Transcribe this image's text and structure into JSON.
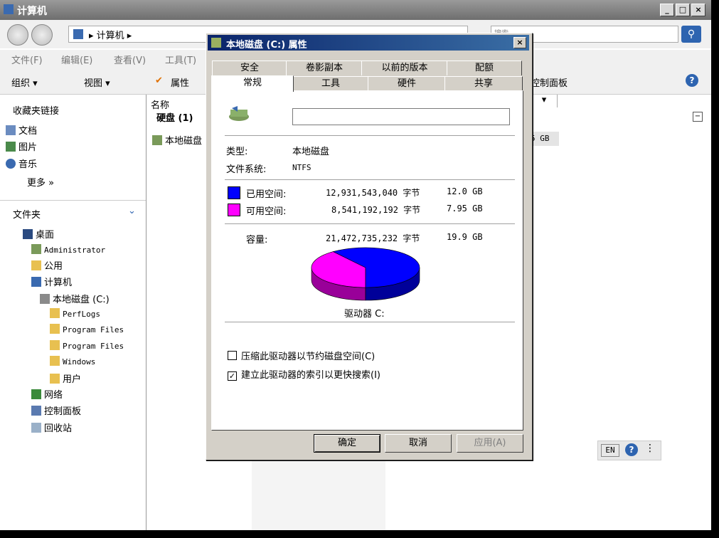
{
  "explorer": {
    "title": "计算机",
    "breadcrumb": "▸ 计算机 ▸",
    "search_placeholder": "搜索",
    "menu": [
      "文件(F)",
      "编辑(E)",
      "查看(V)",
      "工具(T)"
    ],
    "toolbar": {
      "organize": "组织 ▾",
      "views": "视图 ▾",
      "properties": "属性",
      "control_panel": "控制面板"
    },
    "favorites_title": "收藏夹链接",
    "favorites": [
      "文档",
      "图片",
      "音乐"
    ],
    "more": "更多 »",
    "folders_title": "文件夹",
    "tree": [
      "桌面",
      "Administrator",
      "公用",
      "计算机",
      "本地磁盘 (C:)",
      "PerfLogs",
      "Program Files",
      "Program Files",
      "Windows",
      "用户",
      "网络",
      "控制面板",
      "回收站"
    ],
    "column_name": "名称",
    "group_title": "硬盘 (1)",
    "drive_item": "本地磁盘",
    "drive_size_tail": "5 GB",
    "lang": "EN"
  },
  "dialog": {
    "title": "本地磁盘 (C:) 属性",
    "tabs_back": [
      "安全",
      "卷影副本",
      "以前的版本",
      "配额"
    ],
    "tabs_front": [
      "常规",
      "工具",
      "硬件",
      "共享"
    ],
    "type_label": "类型:",
    "type_value": "本地磁盘",
    "fs_label": "文件系统:",
    "fs_value": "NTFS",
    "used_label": "已用空间:",
    "used_bytes": "12,931,543,040 字节",
    "used_gb": "12.0 GB",
    "free_label": "可用空间:",
    "free_bytes": "8,541,192,192 字节",
    "free_gb": "7.95 GB",
    "cap_label": "容量:",
    "cap_bytes": "21,472,735,232 字节",
    "cap_gb": "19.9 GB",
    "drive_label": "驱动器 C:",
    "compress": "压缩此驱动器以节约磁盘空间(C)",
    "index": "建立此驱动器的索引以更快搜索(I)",
    "ok": "确定",
    "cancel": "取消",
    "apply": "应用(A)",
    "used_fraction": 0.6022,
    "colors": {
      "used": "#0000ff",
      "free": "#ff00ff"
    }
  }
}
